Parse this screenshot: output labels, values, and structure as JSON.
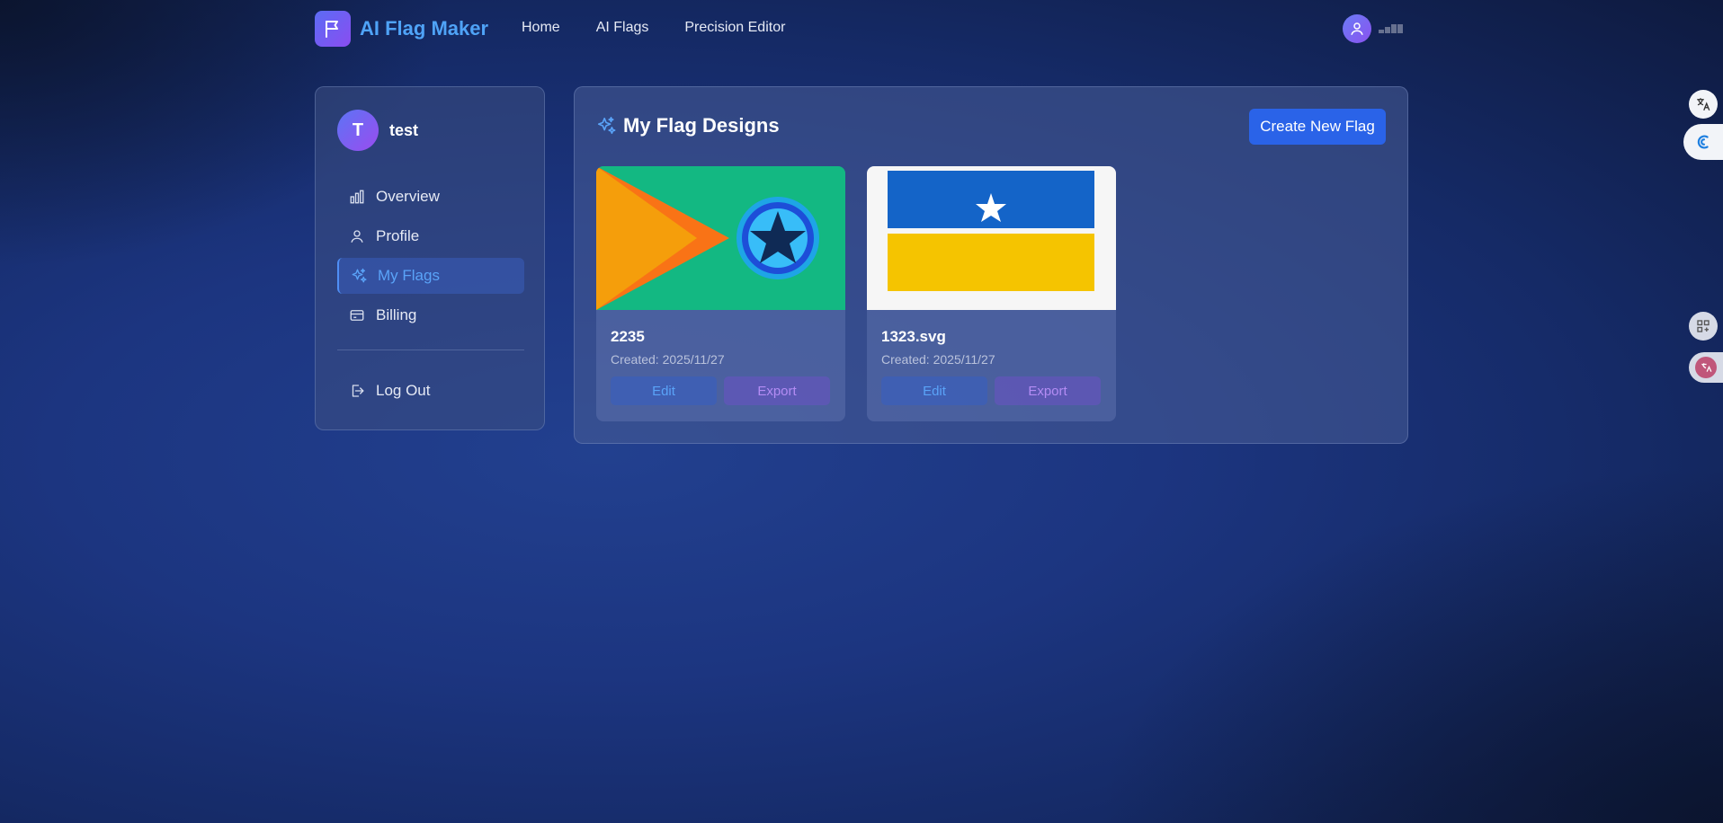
{
  "app": {
    "name": "AI Flag Maker"
  },
  "nav": {
    "links": [
      "Home",
      "AI Flags",
      "Precision Editor"
    ]
  },
  "sidebar": {
    "user": {
      "initial": "T",
      "name": "test"
    },
    "items": [
      {
        "label": "Overview",
        "icon": "bar-chart-icon"
      },
      {
        "label": "Profile",
        "icon": "user-icon"
      },
      {
        "label": "My Flags",
        "icon": "sparkles-icon",
        "active": true
      },
      {
        "label": "Billing",
        "icon": "credit-card-icon"
      }
    ],
    "logout_label": "Log Out"
  },
  "main": {
    "title": "My Flag Designs",
    "create_label": "Create New Flag",
    "cards": [
      {
        "name": "2235",
        "created": "Created: 2025/11/27",
        "edit_label": "Edit",
        "export_label": "Export"
      },
      {
        "name": "1323.svg",
        "created": "Created: 2025/11/27",
        "edit_label": "Edit",
        "export_label": "Export"
      }
    ]
  },
  "colors": {
    "accent": "#2a63e8",
    "link": "#4fa3f7",
    "export": "#b38cf4"
  }
}
